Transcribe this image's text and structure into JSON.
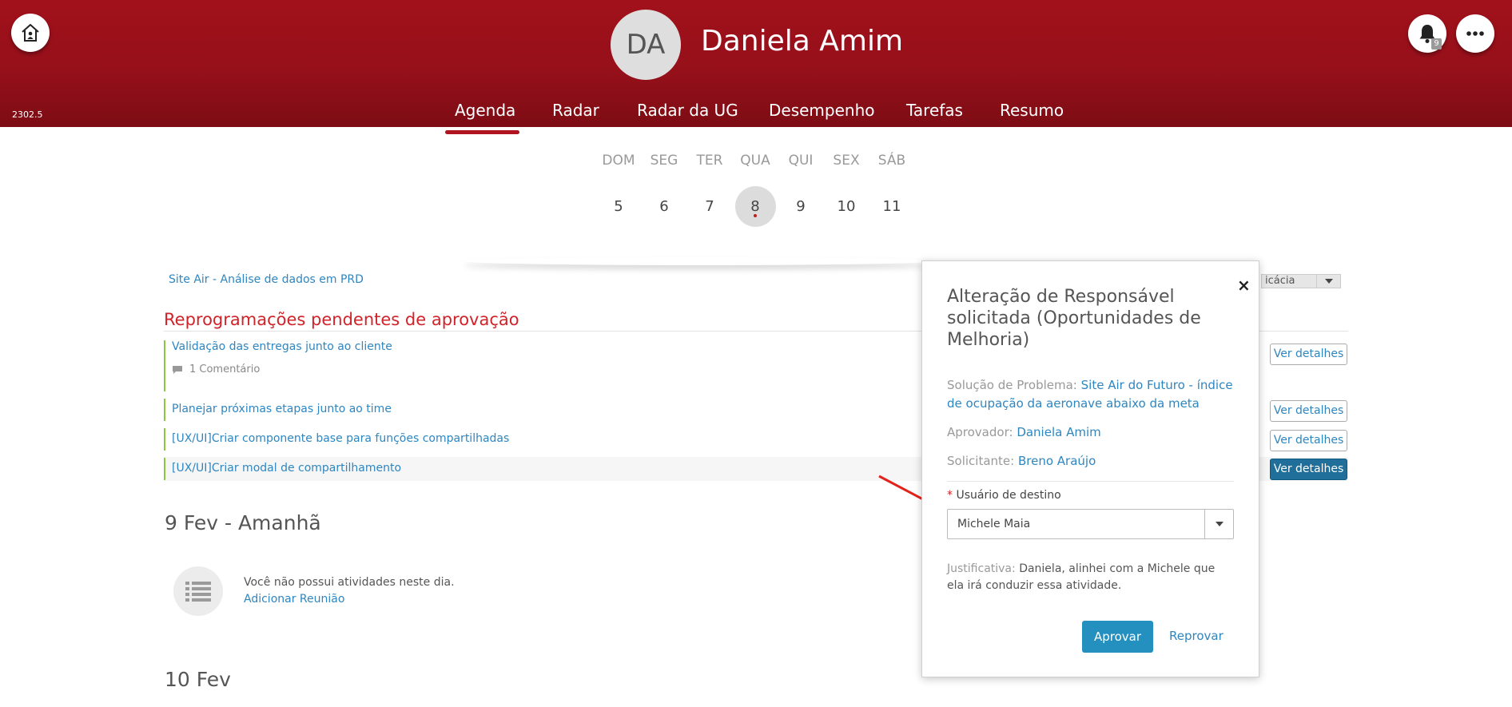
{
  "header": {
    "version": "2302.5",
    "avatar_initials": "DA",
    "user_name": "Daniela Amim",
    "notification_count": "9",
    "colors": {
      "header_bg": "#a1111b",
      "accent_blue": "#2e86c1",
      "section_red": "#d1232a",
      "task_bar_green": "#8dc63f"
    }
  },
  "nav": {
    "items": [
      "Agenda",
      "Radar",
      "Radar da UG",
      "Desempenho",
      "Tarefas",
      "Resumo"
    ],
    "active": "Agenda"
  },
  "week": {
    "days": [
      "DOM",
      "SEG",
      "TER",
      "QUA",
      "QUI",
      "SEX",
      "SÁB"
    ],
    "dates": [
      "5",
      "6",
      "7",
      "8",
      "9",
      "10",
      "11"
    ],
    "selected": "8"
  },
  "content": {
    "site_air_link": "Site Air - Análise de dados em PRD",
    "filter_text": "icácia",
    "section_title": "Reprogramações pendentes de aprovação",
    "tasks": [
      {
        "title": "Validação das entregas junto ao cliente",
        "comment": "1 Comentário",
        "button": "Ver detalhes"
      },
      {
        "title": "Planejar próximas etapas junto ao time",
        "button": "Ver detalhes"
      },
      {
        "title": "[UX/UI]Criar componente base para funções compartilhadas",
        "button": "Ver detalhes"
      },
      {
        "title": "[UX/UI]Criar modal de compartilhamento",
        "button": "Ver detalhes"
      }
    ],
    "day_tomorrow": "9 Fev - Amanhã",
    "empty_text": "Você não possui atividades neste dia.",
    "add_meeting": "Adicionar Reunião",
    "day_next": "10 Fev"
  },
  "popup": {
    "title": "Alteração de Responsável solicitada (Oportunidades de Melhoria)",
    "close": "×",
    "problem_label": "Solução de Problema:",
    "problem_value": "Site Air do Futuro - índice de ocupação da aeronave abaixo da meta",
    "approver_label": "Aprovador:",
    "approver_value": "Daniela Amim",
    "requester_label": "Solicitante:",
    "requester_value": "Breno Araújo",
    "required_star": "*",
    "target_label": "Usuário de destino",
    "target_value": "Michele Maia",
    "justification_label": "Justificativa:",
    "justification_value": "Daniela, alinhei com a Michele que ela irá conduzir essa atividade.",
    "approve": "Aprovar",
    "reject": "Reprovar"
  }
}
